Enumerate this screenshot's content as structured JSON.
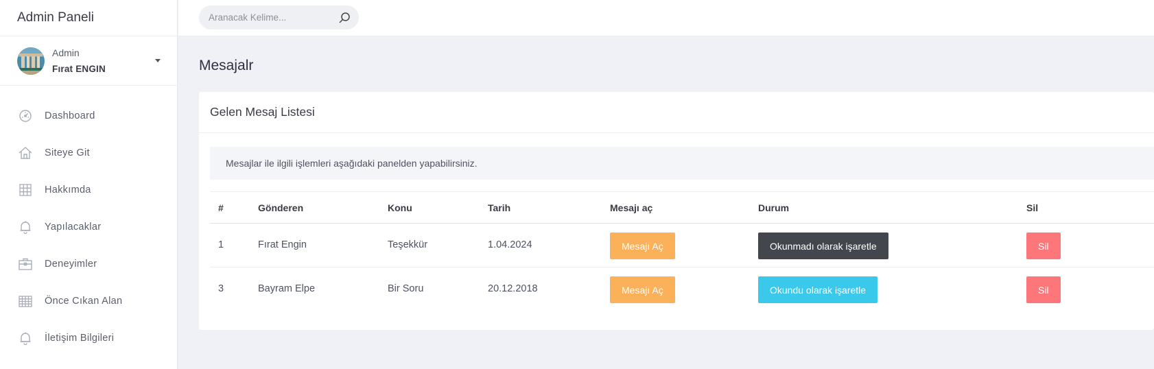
{
  "app": {
    "title": "Admin Paneli"
  },
  "profile": {
    "role": "Admin",
    "name": "Fırat ENGIN"
  },
  "sidebar": {
    "items": [
      {
        "label": "Dashboard",
        "icon": "dashboard-gauge-icon"
      },
      {
        "label": "Siteye Git",
        "icon": "home-icon"
      },
      {
        "label": "Hakkımda",
        "icon": "grid-icon"
      },
      {
        "label": "Yapılacaklar",
        "icon": "bell-icon"
      },
      {
        "label": "Deneyimler",
        "icon": "briefcase-icon"
      },
      {
        "label": "Önce Cıkan Alan",
        "icon": "table-grid-icon"
      },
      {
        "label": "İletişim Bilgileri",
        "icon": "bell-icon"
      }
    ]
  },
  "search": {
    "placeholder": "Aranacak Kelime...",
    "value": ""
  },
  "page": {
    "title": "Mesajalr"
  },
  "card": {
    "title": "Gelen Mesaj Listesi",
    "info": "Mesajlar ile ilgili işlemleri aşağıdaki panelden yapabilirsiniz."
  },
  "table": {
    "headers": [
      "#",
      "Gönderen",
      "Konu",
      "Tarih",
      "Mesajı aç",
      "Durum",
      "Sil"
    ],
    "rows": [
      {
        "id": "1",
        "sender": "Fırat Engin",
        "subject": "Teşekkür",
        "date": "1.04.2024",
        "open_label": "Mesajı Aç",
        "status_label": "Okunmadı olarak işaretle",
        "status_style": "dark",
        "delete_label": "Sil"
      },
      {
        "id": "3",
        "sender": "Bayram Elpe",
        "subject": "Bir Soru",
        "date": "20.12.2018",
        "open_label": "Mesajı Aç",
        "status_label": "Okundu olarak işaretle",
        "status_style": "info",
        "delete_label": "Sil"
      }
    ]
  },
  "colors": {
    "warning": "#fbb05a",
    "dark": "#43474d",
    "info": "#3ac9ea",
    "danger": "#fd767a",
    "background": "#f0f1f6"
  }
}
